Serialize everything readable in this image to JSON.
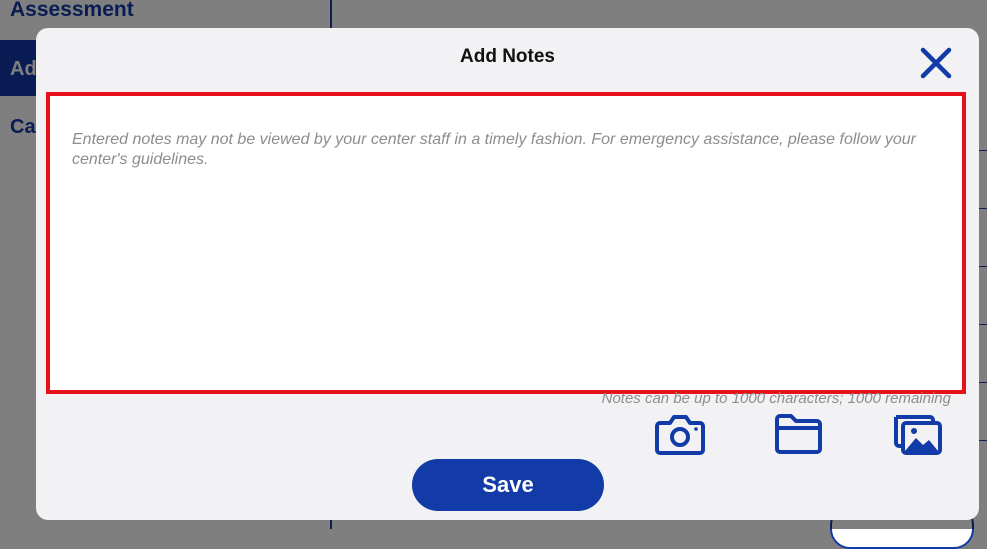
{
  "background": {
    "page_title": "Assessment",
    "nav_active_label": "Ad",
    "nav_item_label": "Ca"
  },
  "modal": {
    "title": "Add Notes",
    "notes_placeholder": "Entered notes may not be viewed by your center staff in a timely fashion. For emergency assistance, please follow your center's guidelines.",
    "char_count": "Notes can be up to 1000 characters; 1000 remaining",
    "save_label": "Save",
    "icons": [
      "close-icon",
      "camera-icon",
      "folder-icon",
      "gallery-icon"
    ]
  },
  "colors": {
    "accent": "#123ba8",
    "highlight_border": "#e8111a",
    "modal_bg": "#f2f2f4"
  }
}
